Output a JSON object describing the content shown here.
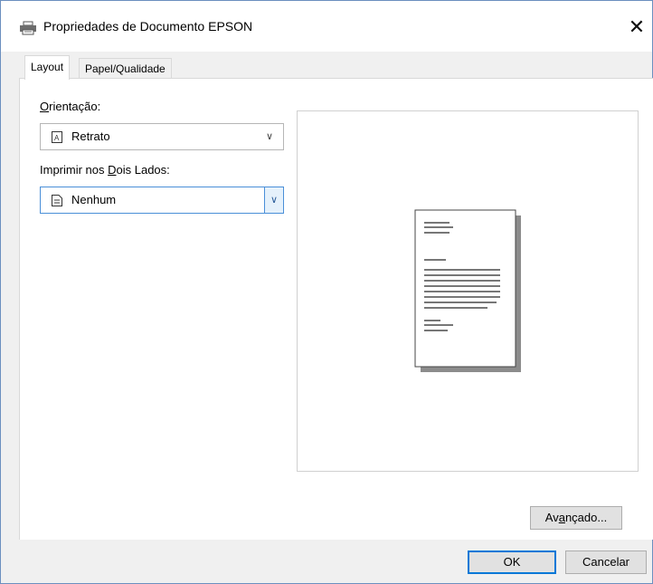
{
  "window": {
    "title": "Propriedades de Documento EPSON",
    "close_glyph": "✕"
  },
  "tabs": [
    {
      "label": "Layout",
      "active": true
    },
    {
      "label": "Papel/Qualidade",
      "active": false
    }
  ],
  "orientation": {
    "label_accel": "O",
    "label_rest": "rientação:",
    "value": "Retrato",
    "icon": "portrait-page-icon"
  },
  "duplex": {
    "label_before": "Imprimir nos ",
    "label_accel": "D",
    "label_after": "ois Lados:",
    "value": "Nenhum",
    "icon": "single-page-icon"
  },
  "buttons": {
    "advanced_pre": "Av",
    "advanced_accel": "a",
    "advanced_post": "nçado...",
    "ok": "OK",
    "cancel": "Cancelar"
  },
  "icons": {
    "title": "printer-icon",
    "dropdown": "chevron-down-icon"
  },
  "colors": {
    "focus_accent": "#4a8fd8",
    "default_button_border": "#0078d7"
  }
}
